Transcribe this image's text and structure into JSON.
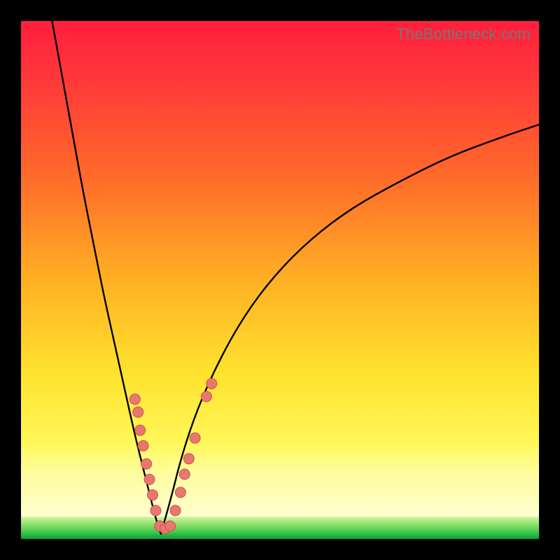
{
  "watermark": "TheBottleneck.com",
  "colors": {
    "frame": "#000000",
    "curve": "#000000",
    "point_fill": "#e8786f",
    "point_stroke": "#c9534a",
    "green_band_top": "#b4f08c",
    "green_band_mid": "#3cc84c",
    "green_band_bot": "#0aa038"
  },
  "chart_data": {
    "type": "line",
    "title": "",
    "xlabel": "",
    "ylabel": "",
    "xlim": [
      0,
      100
    ],
    "ylim": [
      0,
      100
    ],
    "note": "Values are read off a 100x100 normalized plot area. y=0 is bottom (green zone), y=100 is top (red zone). Curve is a V-shaped bottleneck profile with minimum near x≈27.",
    "series": [
      {
        "name": "curve-left",
        "x": [
          6,
          8,
          10,
          12,
          14,
          16,
          18,
          20,
          22,
          24,
          25,
          26,
          27
        ],
        "y": [
          100,
          89,
          78,
          67,
          57,
          47,
          38,
          29,
          20,
          12,
          8,
          4,
          1
        ]
      },
      {
        "name": "curve-right",
        "x": [
          27,
          29,
          31,
          34,
          38,
          43,
          49,
          56,
          64,
          73,
          83,
          94,
          100
        ],
        "y": [
          1,
          8,
          16,
          25,
          34,
          43,
          51,
          58,
          64,
          69,
          74,
          78,
          80
        ]
      },
      {
        "name": "data-points",
        "points": [
          {
            "x": 22.0,
            "y": 27.0
          },
          {
            "x": 22.6,
            "y": 24.5
          },
          {
            "x": 23.0,
            "y": 21.0
          },
          {
            "x": 23.6,
            "y": 18.0
          },
          {
            "x": 24.2,
            "y": 14.5
          },
          {
            "x": 24.8,
            "y": 11.5
          },
          {
            "x": 25.4,
            "y": 8.5
          },
          {
            "x": 26.0,
            "y": 5.5
          },
          {
            "x": 26.8,
            "y": 2.5
          },
          {
            "x": 27.8,
            "y": 2.0
          },
          {
            "x": 28.8,
            "y": 2.5
          },
          {
            "x": 29.8,
            "y": 5.5
          },
          {
            "x": 30.8,
            "y": 9.0
          },
          {
            "x": 31.6,
            "y": 12.5
          },
          {
            "x": 32.4,
            "y": 15.5
          },
          {
            "x": 33.6,
            "y": 19.5
          },
          {
            "x": 35.8,
            "y": 27.5
          },
          {
            "x": 36.8,
            "y": 30.0
          }
        ]
      }
    ],
    "green_band": {
      "y_from": 0,
      "y_to": 4
    },
    "pale_band": {
      "y_from": 4,
      "y_to": 15
    }
  }
}
